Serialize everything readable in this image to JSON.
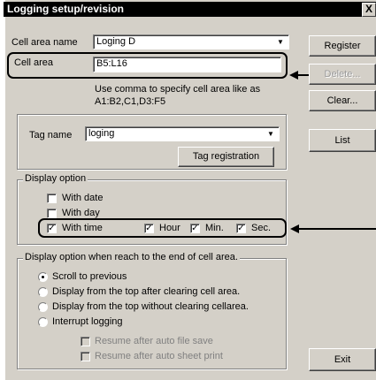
{
  "window": {
    "title": "Logging setup/revision",
    "close_glyph": "X"
  },
  "cell_area_name": {
    "label": "Cell area name",
    "value": "Loging D"
  },
  "cell_area": {
    "label": "Cell area",
    "value": "B5:L16",
    "hint_line1": "Use comma to specify cell area like as",
    "hint_line2": "A1:B2,C1,D3:F5"
  },
  "buttons": {
    "register": "Register",
    "delete": "Delete...",
    "clear": "Clear...",
    "list": "List",
    "exit": "Exit",
    "tag_registration": "Tag registration"
  },
  "tag": {
    "label": "Tag name",
    "value": "loging"
  },
  "display_option": {
    "title": "Display option",
    "with_date": {
      "label": "With date",
      "checked": false
    },
    "with_day": {
      "label": "With day",
      "checked": false
    },
    "with_time": {
      "label": "With time",
      "checked": true
    },
    "hour": {
      "label": "Hour",
      "checked": true
    },
    "min": {
      "label": "Min.",
      "checked": true
    },
    "sec": {
      "label": "Sec.",
      "checked": true
    }
  },
  "end_option": {
    "title": "Display option when reach to the end of cell area.",
    "scroll": {
      "label": "Scroll to previous",
      "selected": true
    },
    "top_clear": {
      "label": "Display from the top after clearing cell area.",
      "selected": false
    },
    "top_noclear": {
      "label": "Display from the top without clearing cellarea.",
      "selected": false
    },
    "interrupt": {
      "label": "Interrupt logging",
      "selected": false
    },
    "resume_save": {
      "label": "Resume after auto file save",
      "checked": false
    },
    "resume_print": {
      "label": "Resume after auto sheet print",
      "checked": false
    }
  },
  "check_glyph": "✓",
  "icons": {
    "dropdown": "▼"
  }
}
